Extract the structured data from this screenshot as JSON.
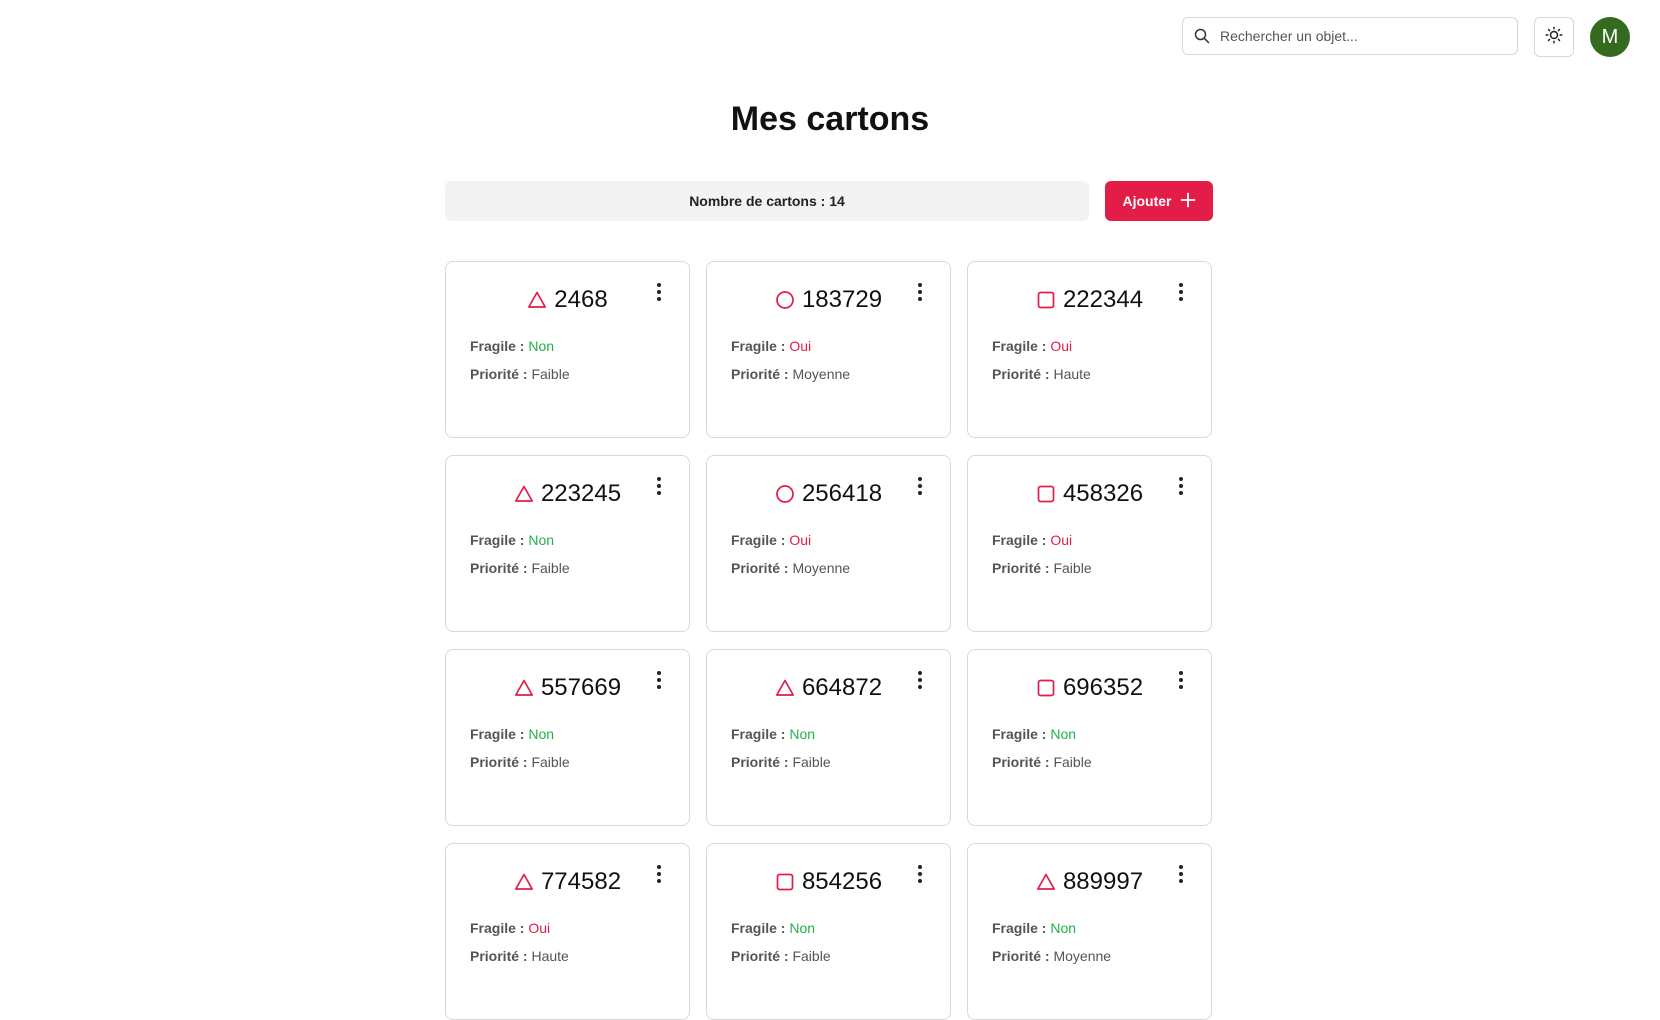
{
  "search": {
    "placeholder": "Rechercher un objet..."
  },
  "avatar": {
    "initial": "M"
  },
  "page_title": "Mes cartons",
  "count": {
    "label": "Nombre de cartons : 14"
  },
  "add_button": {
    "label": "Ajouter"
  },
  "labels": {
    "fragile": "Fragile :",
    "priority": "Priorité :"
  },
  "colors": {
    "accent": "#e11d48",
    "no": "#22b14c",
    "avatar": "#356b1f"
  },
  "cards": [
    {
      "shape": "triangle-icon",
      "number": "2468",
      "fragile": "Non",
      "priority": "Faible"
    },
    {
      "shape": "circle-icon",
      "number": "183729",
      "fragile": "Oui",
      "priority": "Moyenne"
    },
    {
      "shape": "square-icon",
      "number": "222344",
      "fragile": "Oui",
      "priority": "Haute"
    },
    {
      "shape": "triangle-icon",
      "number": "223245",
      "fragile": "Non",
      "priority": "Faible"
    },
    {
      "shape": "circle-icon",
      "number": "256418",
      "fragile": "Oui",
      "priority": "Moyenne"
    },
    {
      "shape": "square-icon",
      "number": "458326",
      "fragile": "Oui",
      "priority": "Faible"
    },
    {
      "shape": "triangle-icon",
      "number": "557669",
      "fragile": "Non",
      "priority": "Faible"
    },
    {
      "shape": "triangle-icon",
      "number": "664872",
      "fragile": "Non",
      "priority": "Faible"
    },
    {
      "shape": "square-icon",
      "number": "696352",
      "fragile": "Non",
      "priority": "Faible"
    },
    {
      "shape": "triangle-icon",
      "number": "774582",
      "fragile": "Oui",
      "priority": "Haute"
    },
    {
      "shape": "square-icon",
      "number": "854256",
      "fragile": "Non",
      "priority": "Faible"
    },
    {
      "shape": "triangle-icon",
      "number": "889997",
      "fragile": "Non",
      "priority": "Moyenne"
    }
  ]
}
